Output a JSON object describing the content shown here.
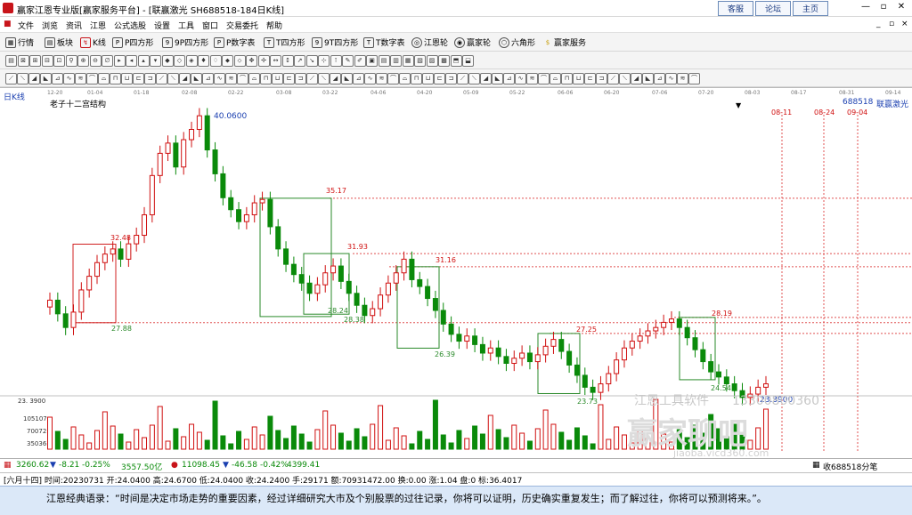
{
  "window": {
    "title": "赢家江恩专业版[赢家服务平台] - [联赢激光  SH688518-184日K线]",
    "links": [
      "客服",
      "论坛",
      "主页"
    ]
  },
  "menu": [
    "文件",
    "浏览",
    "资讯",
    "江恩",
    "公式选股",
    "设置",
    "工具",
    "窗口",
    "交易委托",
    "帮助"
  ],
  "toolbar1": [
    "行情",
    "板块",
    "K线",
    "P四方形",
    "9P四方形",
    "P数字表",
    "T四方形",
    "9T四方形",
    "T数字表",
    "江恩轮",
    "赢家轮",
    "六角形",
    "赢家服务"
  ],
  "chart": {
    "period_label": "日K线",
    "indicator_label": "老子十二宫结构",
    "stock_code": "688518",
    "stock_name": "联赢激光",
    "date_ticks": [
      "12-20",
      "01-04",
      "01-18",
      "02-08",
      "02-22",
      "03-08",
      "03-22",
      "04-06",
      "04-20",
      "05-09",
      "05-22",
      "06-06",
      "06-20",
      "07-06",
      "07-20",
      "08-03",
      "08-17",
      "08-31",
      "09-14"
    ],
    "future_dates": [
      "08-11",
      "08-24",
      "09-04"
    ],
    "price_labels": [
      "40.0600",
      "35.17",
      "32.48",
      "31.93",
      "31.16",
      "28.19",
      "28.24",
      "28.38",
      "27.88",
      "27.25",
      "26.39",
      "24.54",
      "23.73",
      "23.3900"
    ],
    "volume_axis": [
      "23. 3900",
      "105107",
      "70072",
      "35036"
    ],
    "watermark": [
      "江恩工具软件",
      "13300800360"
    ],
    "watermark_large": "赢家聊吧",
    "watermark_url": "jiaoba.vicd360.com"
  },
  "status1": {
    "sh_index": "3260.62",
    "sh_change": "-8.21",
    "sh_pct": "-0.25%",
    "sh_amount": "3557.50亿",
    "sz_index": "11098.45",
    "sz_change": "-46.58",
    "sz_pct": "-0.42%",
    "sz_amount": "4399.41",
    "right_text": "收688518分笔"
  },
  "status2": {
    "text": "[六月十四] 时间:20230731 开:24.0400 高:24.6700 低:24.0400 收:24.2400 手:29171 额:70931472.00 换:0.00 涨:1.04 盘:0 标:36.4017"
  },
  "quote": "江恩经典语录：“时间是决定市场走势的重要因素，经过详细研究大市及个别股票的过往记录，你将可以证明，历史确实重复发生；而了解过往，你将可以预测将来。”。",
  "colors": {
    "up": "#d01010",
    "down": "#0a8a0a",
    "box": "#2a8a2a",
    "level": "#e04040",
    "quote_bg": "#dbe8f8"
  }
}
